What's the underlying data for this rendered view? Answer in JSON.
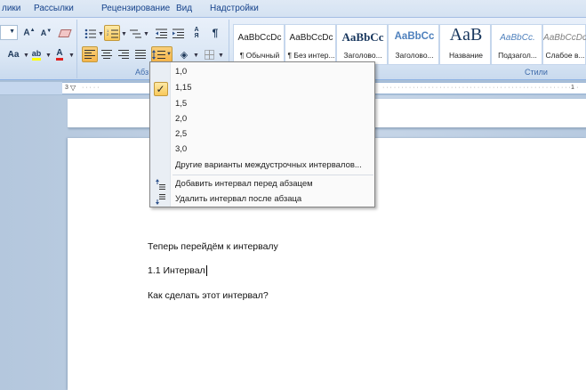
{
  "tabs": [
    "лики",
    "Рассылки",
    "Рецензирование",
    "Вид",
    "Надстройки"
  ],
  "ribbon": {
    "paragraph_group_label": "Абз",
    "styles_group_label": "Стили",
    "font_size_grow_label": "A",
    "font_case_label": "Aa",
    "styles": [
      {
        "sample": "AaBbCcDc",
        "name": "¶ Обычный"
      },
      {
        "sample": "AaBbCcDc",
        "name": "¶ Без интер..."
      },
      {
        "sample": "AaBbCc",
        "name": "Заголово..."
      },
      {
        "sample": "AaBbCc",
        "name": "Заголово..."
      },
      {
        "sample": "AaB",
        "name": "Название"
      },
      {
        "sample": "AaBbCc.",
        "name": "Подзагол..."
      },
      {
        "sample": "AaBbCcDc",
        "name": "Слабое в..."
      }
    ]
  },
  "ruler": {
    "marks": [
      "3",
      "1"
    ]
  },
  "line_spacing_menu": {
    "options": [
      "1,0",
      "1,15",
      "1,5",
      "2,0",
      "2,5",
      "3,0"
    ],
    "selected": "1,15",
    "more_label": "Другие варианты междустрочных интервалов...",
    "add_before_label": "Добавить интервал перед абзацем",
    "remove_after_label": "Удалить интервал после абзаца"
  },
  "document": {
    "line1": "Теперь перейдём к интервалу",
    "line2": "1.1  Интервал",
    "line3": "Как сделать этот интервал?"
  },
  "colors": {
    "accent": "#f9c95a",
    "ribbon": "#dbe7f5",
    "text": "#1e395b"
  }
}
